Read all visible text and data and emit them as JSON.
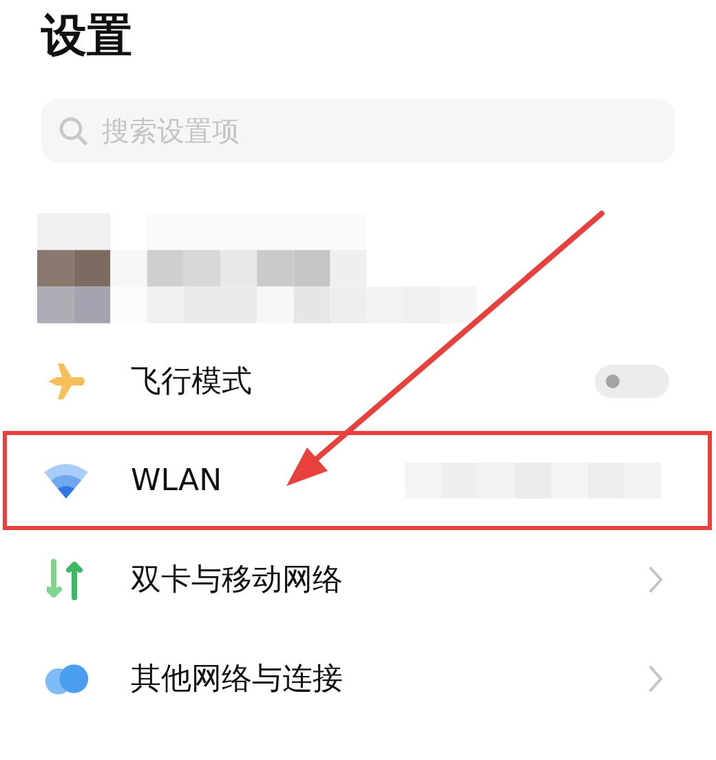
{
  "title": "设置",
  "search": {
    "placeholder": "搜索设置项"
  },
  "items": [
    {
      "kind": "toggle",
      "label": "飞行模式",
      "on": false,
      "highlighted": false
    },
    {
      "kind": "value",
      "label": "WLAN",
      "highlighted": true
    },
    {
      "kind": "link",
      "label": "双卡与移动网络",
      "highlighted": false
    },
    {
      "kind": "link",
      "label": "其他网络与连接",
      "highlighted": false
    }
  ]
}
